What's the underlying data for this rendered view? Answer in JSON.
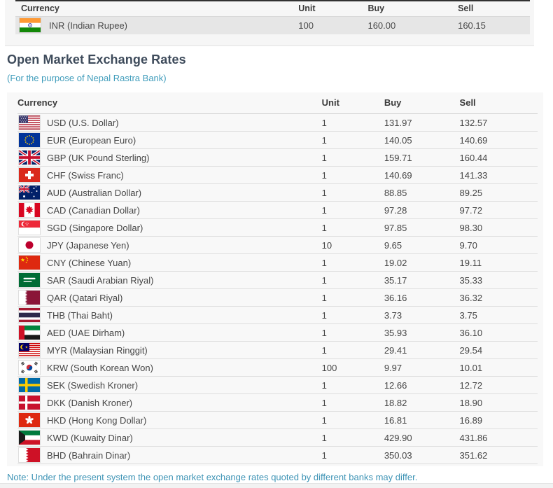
{
  "top_table": {
    "headers": {
      "currency": "Currency",
      "unit": "Unit",
      "buy": "Buy",
      "sell": "Sell"
    },
    "rows": [
      {
        "flag": "inr",
        "currency": "INR (Indian Rupee)",
        "unit": "100",
        "buy": "160.00",
        "sell": "160.15"
      }
    ]
  },
  "section": {
    "title": "Open Market Exchange Rates",
    "subtitle": "(For the purpose of Nepal Rastra Bank)"
  },
  "main_table": {
    "headers": {
      "currency": "Currency",
      "unit": "Unit",
      "buy": "Buy",
      "sell": "Sell"
    },
    "rows": [
      {
        "flag": "usd",
        "currency": "USD (U.S. Dollar)",
        "unit": "1",
        "buy": "131.97",
        "sell": "132.57"
      },
      {
        "flag": "eur",
        "currency": "EUR (European Euro)",
        "unit": "1",
        "buy": "140.05",
        "sell": "140.69"
      },
      {
        "flag": "gbp",
        "currency": "GBP (UK Pound Sterling)",
        "unit": "1",
        "buy": "159.71",
        "sell": "160.44"
      },
      {
        "flag": "chf",
        "currency": "CHF (Swiss Franc)",
        "unit": "1",
        "buy": "140.69",
        "sell": "141.33"
      },
      {
        "flag": "aud",
        "currency": "AUD (Australian Dollar)",
        "unit": "1",
        "buy": "88.85",
        "sell": "89.25"
      },
      {
        "flag": "cad",
        "currency": "CAD (Canadian Dollar)",
        "unit": "1",
        "buy": "97.28",
        "sell": "97.72"
      },
      {
        "flag": "sgd",
        "currency": "SGD (Singapore Dollar)",
        "unit": "1",
        "buy": "97.85",
        "sell": "98.30"
      },
      {
        "flag": "jpy",
        "currency": "JPY (Japanese Yen)",
        "unit": "10",
        "buy": "9.65",
        "sell": "9.70"
      },
      {
        "flag": "cny",
        "currency": "CNY (Chinese Yuan)",
        "unit": "1",
        "buy": "19.02",
        "sell": "19.11"
      },
      {
        "flag": "sar",
        "currency": "SAR (Saudi Arabian Riyal)",
        "unit": "1",
        "buy": "35.17",
        "sell": "35.33"
      },
      {
        "flag": "qar",
        "currency": "QAR (Qatari Riyal)",
        "unit": "1",
        "buy": "36.16",
        "sell": "36.32"
      },
      {
        "flag": "thb",
        "currency": "THB (Thai Baht)",
        "unit": "1",
        "buy": "3.73",
        "sell": "3.75"
      },
      {
        "flag": "aed",
        "currency": "AED (UAE Dirham)",
        "unit": "1",
        "buy": "35.93",
        "sell": "36.10"
      },
      {
        "flag": "myr",
        "currency": "MYR (Malaysian Ringgit)",
        "unit": "1",
        "buy": "29.41",
        "sell": "29.54"
      },
      {
        "flag": "krw",
        "currency": "KRW (South Korean Won)",
        "unit": "100",
        "buy": "9.97",
        "sell": "10.01"
      },
      {
        "flag": "sek",
        "currency": "SEK (Swedish Kroner)",
        "unit": "1",
        "buy": "12.66",
        "sell": "12.72"
      },
      {
        "flag": "dkk",
        "currency": "DKK (Danish Kroner)",
        "unit": "1",
        "buy": "18.82",
        "sell": "18.90"
      },
      {
        "flag": "hkd",
        "currency": "HKD (Hong Kong Dollar)",
        "unit": "1",
        "buy": "16.81",
        "sell": "16.89"
      },
      {
        "flag": "kwd",
        "currency": "KWD (Kuwaity Dinar)",
        "unit": "1",
        "buy": "429.90",
        "sell": "431.86"
      },
      {
        "flag": "bhd",
        "currency": "BHD (Bahrain Dinar)",
        "unit": "1",
        "buy": "350.03",
        "sell": "351.62"
      }
    ]
  },
  "note": "Note: Under the present system the open market exchange rates quoted by different banks may differ.",
  "colors": {
    "accent_teal": "#3f9cbb",
    "heading": "#3e4b5b",
    "row_highlight": "#e6e6e6",
    "table_bg": "#f8f8f8",
    "header_border": "#313131"
  }
}
